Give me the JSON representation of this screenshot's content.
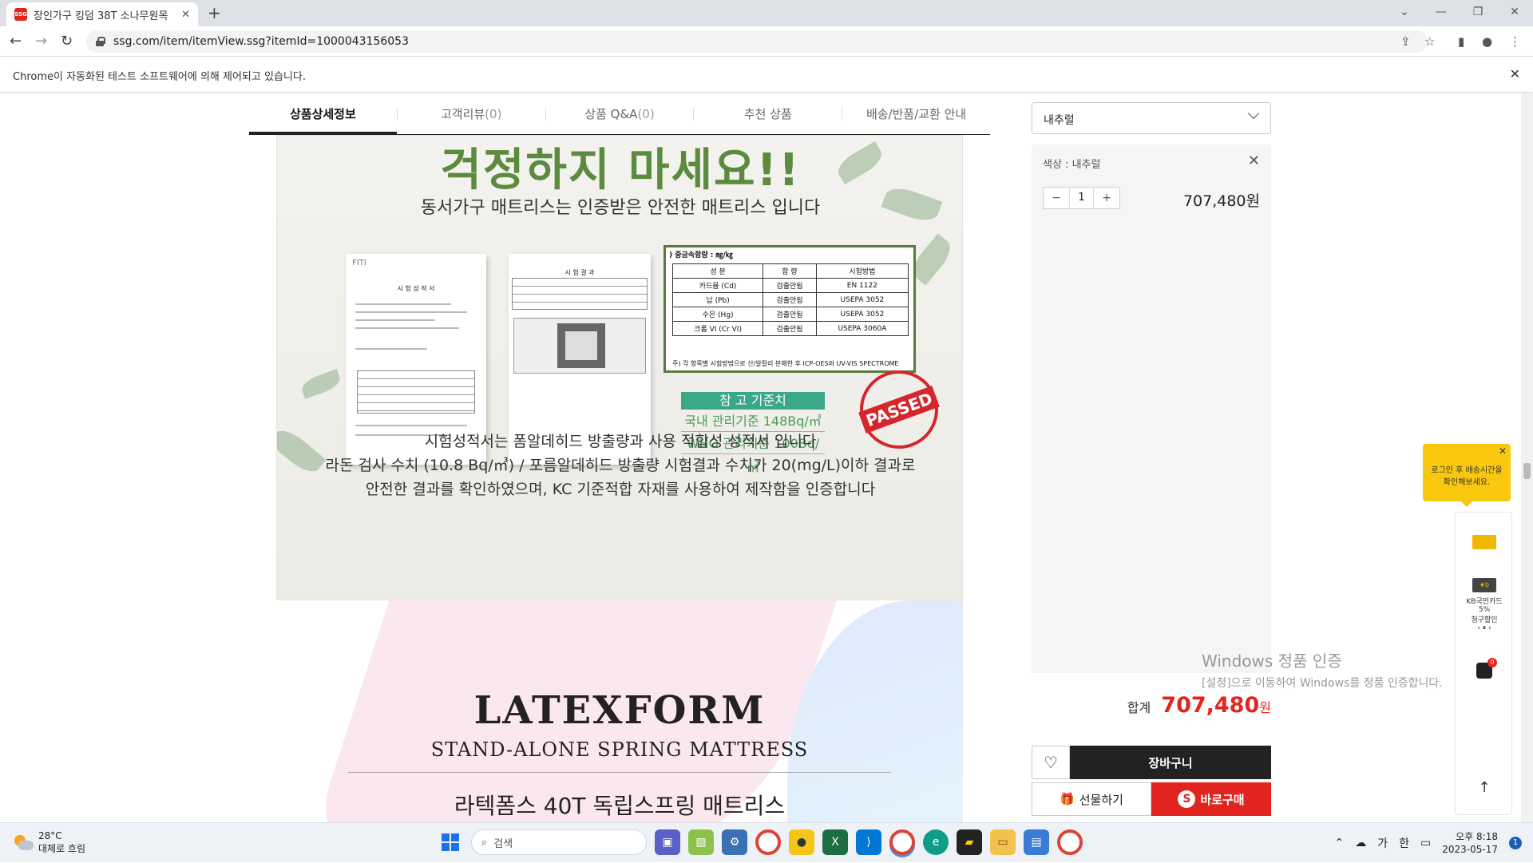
{
  "browser": {
    "tab_title": "장인가구 킹덤 38T 소나무원목",
    "url": "ssg.com/item/itemView.ssg?itemId=1000043156053",
    "infobar_text": "Chrome이 자동화된 테스트 소프트웨어에 의해 제어되고 있습니다."
  },
  "detail_tabs": [
    {
      "label": "상품상세정보",
      "count": ""
    },
    {
      "label": "고객리뷰",
      "count": "(0)"
    },
    {
      "label": "상품 Q&A",
      "count": "(0)"
    },
    {
      "label": "추천 상품",
      "count": ""
    },
    {
      "label": "배송/반품/교환 안내",
      "count": ""
    }
  ],
  "product_image": {
    "headline": "걱정하지 마세요!!",
    "subhead": "동서가구 매트리스는 인증받은 안전한 매트리스 입니다",
    "doc1_logo": "FITI",
    "doc1_title": "시 험 성 적 서",
    "doc2_title": "시 험 결 과",
    "metal_table": {
      "header": ") 중금속함량 : ㎎/㎏",
      "columns": [
        "성 분",
        "함 량",
        "시험방법"
      ],
      "rows": [
        [
          "카드뮴 (Cd)",
          "검출안됨",
          "EN 1122"
        ],
        [
          "납 (Pb)",
          "검출안됨",
          "USEPA 3052"
        ],
        [
          "수은 (Hg)",
          "검출안됨",
          "USEPA 3052"
        ],
        [
          "크롬 VI (Cr VI)",
          "검출안됨",
          "USEPA 3060A"
        ]
      ],
      "footer": "주) 각 항목별 시험방법으로 산/알칼리 분해한 후 ICP-OES와 UV-VIS SPECTROME"
    },
    "ref_title": "참 고 기준치",
    "ref_rows": [
      "국내 관리기준 148Bq/㎥",
      "WHO 관리기준 100Bq/㎥"
    ],
    "stamp": "PASSED",
    "desc_lines": [
      "시험성적서는 폼알데히드 방출량과 사용 적합성 성적서 입니다",
      "라돈 검사 수치 (10.8 Bq/㎥) / 포름알데히드 방출량 시험결과 수치가 20(mg/L)이하 결과로",
      "안전한 결과를 확인하였으며, KC 기준적합 자재를 사용하여 제작함을 인증합니다"
    ],
    "brand": "LATEXFORM",
    "brand_sub": "STAND-ALONE SPRING MATTRESS",
    "korean_name": "라텍폼스 40T 독립스프링 매트리스"
  },
  "order_panel": {
    "option_select": "내추럴",
    "selected_option": "색상 : 내추럴",
    "quantity": "1",
    "minus": "−",
    "plus": "+",
    "option_price": "707,480원",
    "total_label": "합계",
    "total_amount": "707,480",
    "total_unit": "원",
    "cart_label": "장바구니",
    "gift_label": "선물하기",
    "buy_label": "바로구매"
  },
  "watermark": {
    "line1": "Windows 정품 인증",
    "line2": "[설정]으로 이동하여 Windows를 정품 인증합니다."
  },
  "side_float": {
    "tooltip": "로그인 후 배송시간을 확인해보세요.",
    "kb_label": "KB국민카드",
    "kb_percent": "5%",
    "kb_desc": "청구할인",
    "kb_nav": "‹ ⏸ ›",
    "cart_count": "0",
    "top_arrow": "↑"
  },
  "taskbar": {
    "temp": "28°C",
    "weather": "대체로 흐림",
    "search": "검색",
    "ime1": "가",
    "ime2": "한",
    "time": "오후 8:18",
    "date": "2023-05-17",
    "notif_count": "1"
  }
}
